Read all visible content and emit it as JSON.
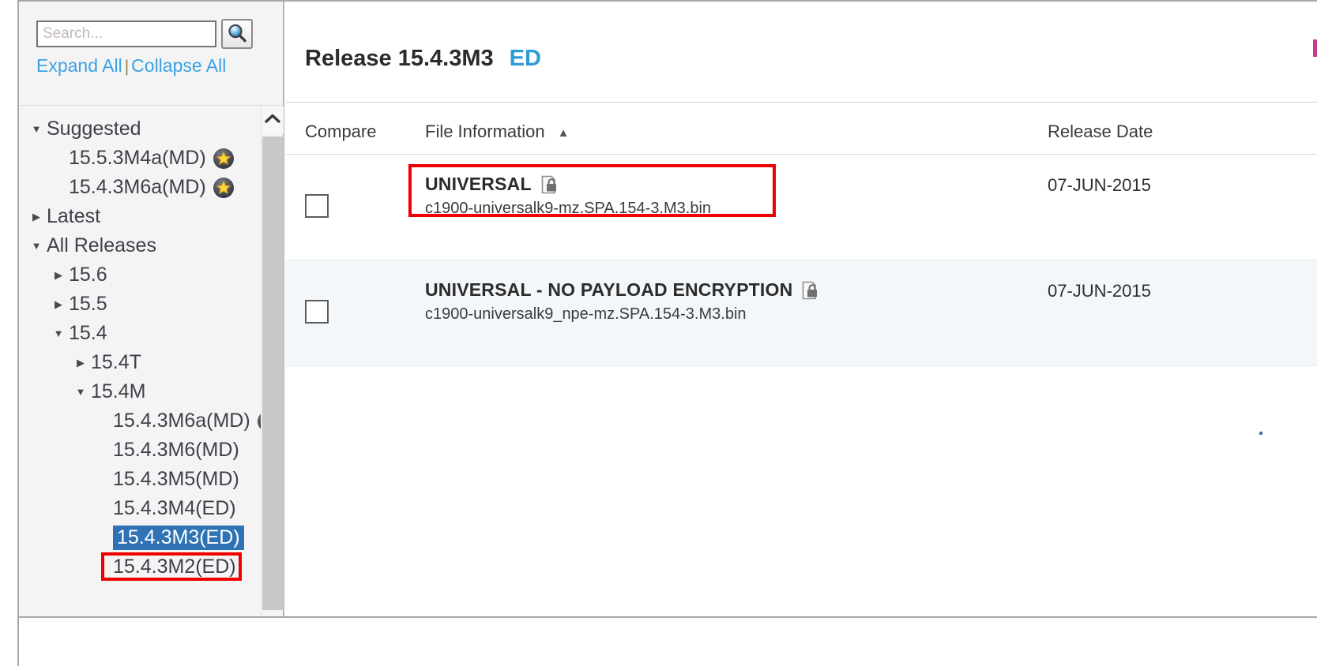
{
  "search": {
    "placeholder": "Search...",
    "value": "",
    "icon": "search-icon",
    "expand_all": "Expand All",
    "separator": "|",
    "collapse_all": "Collapse All"
  },
  "tree": {
    "items": [
      {
        "label": "Suggested",
        "level": 0,
        "caret": "down",
        "star": false,
        "selected": false
      },
      {
        "label": "15.5.3M4a(MD)",
        "level": 1,
        "caret": "none",
        "star": true,
        "selected": false
      },
      {
        "label": "15.4.3M6a(MD)",
        "level": 1,
        "caret": "none",
        "star": true,
        "selected": false
      },
      {
        "label": "Latest",
        "level": 0,
        "caret": "right",
        "star": false,
        "selected": false
      },
      {
        "label": "All Releases",
        "level": 0,
        "caret": "down",
        "star": false,
        "selected": false
      },
      {
        "label": "15.6",
        "level": 1,
        "caret": "right",
        "star": false,
        "selected": false
      },
      {
        "label": "15.5",
        "level": 1,
        "caret": "right",
        "star": false,
        "selected": false
      },
      {
        "label": "15.4",
        "level": 1,
        "caret": "down",
        "star": false,
        "selected": false
      },
      {
        "label": "15.4T",
        "level": 2,
        "caret": "right",
        "star": false,
        "selected": false
      },
      {
        "label": "15.4M",
        "level": 2,
        "caret": "down",
        "star": false,
        "selected": false
      },
      {
        "label": "15.4.3M6a(MD)",
        "level": 3,
        "caret": "none",
        "star": true,
        "selected": false
      },
      {
        "label": "15.4.3M6(MD)",
        "level": 3,
        "caret": "none",
        "star": false,
        "selected": false
      },
      {
        "label": "15.4.3M5(MD)",
        "level": 3,
        "caret": "none",
        "star": false,
        "selected": false
      },
      {
        "label": "15.4.3M4(ED)",
        "level": 3,
        "caret": "none",
        "star": false,
        "selected": false
      },
      {
        "label": "15.4.3M3(ED)",
        "level": 3,
        "caret": "none",
        "star": false,
        "selected": true
      },
      {
        "label": "15.4.3M2(ED)",
        "level": 3,
        "caret": "none",
        "star": false,
        "selected": false
      }
    ],
    "scroll_up_icon": "chevron-up-icon"
  },
  "header": {
    "release_label": "Release 15.4.3M3",
    "release_tag": "ED"
  },
  "table": {
    "columns": {
      "compare": "Compare",
      "file_information": "File Information",
      "sort_indicator": "▲",
      "release_date": "Release Date"
    },
    "rows": [
      {
        "checked": false,
        "title": "UNIVERSAL",
        "lock_icon": "locked-file-icon",
        "filename": "c1900-universalk9-mz.SPA.154-3.M3.bin",
        "release_date": "07-JUN-2015"
      },
      {
        "checked": false,
        "title": "UNIVERSAL - NO PAYLOAD ENCRYPTION",
        "lock_icon": "locked-file-icon",
        "filename": "c1900-universalk9_npe-mz.SPA.154-3.M3.bin",
        "release_date": "07-JUN-2015"
      }
    ]
  },
  "annotations": {
    "highlight_color": "#ee0000",
    "selected_tree_item": "15.4.3M3(ED)",
    "highlighted_row_title": "UNIVERSAL"
  },
  "colors": {
    "link_blue": "#3ba1e4",
    "tag_blue": "#2e9bd6",
    "selection_blue": "#2f73b5",
    "alt_row": "#f3f7fa",
    "panel_bg": "#f4f4f4",
    "annotation_red": "#ee0000"
  }
}
